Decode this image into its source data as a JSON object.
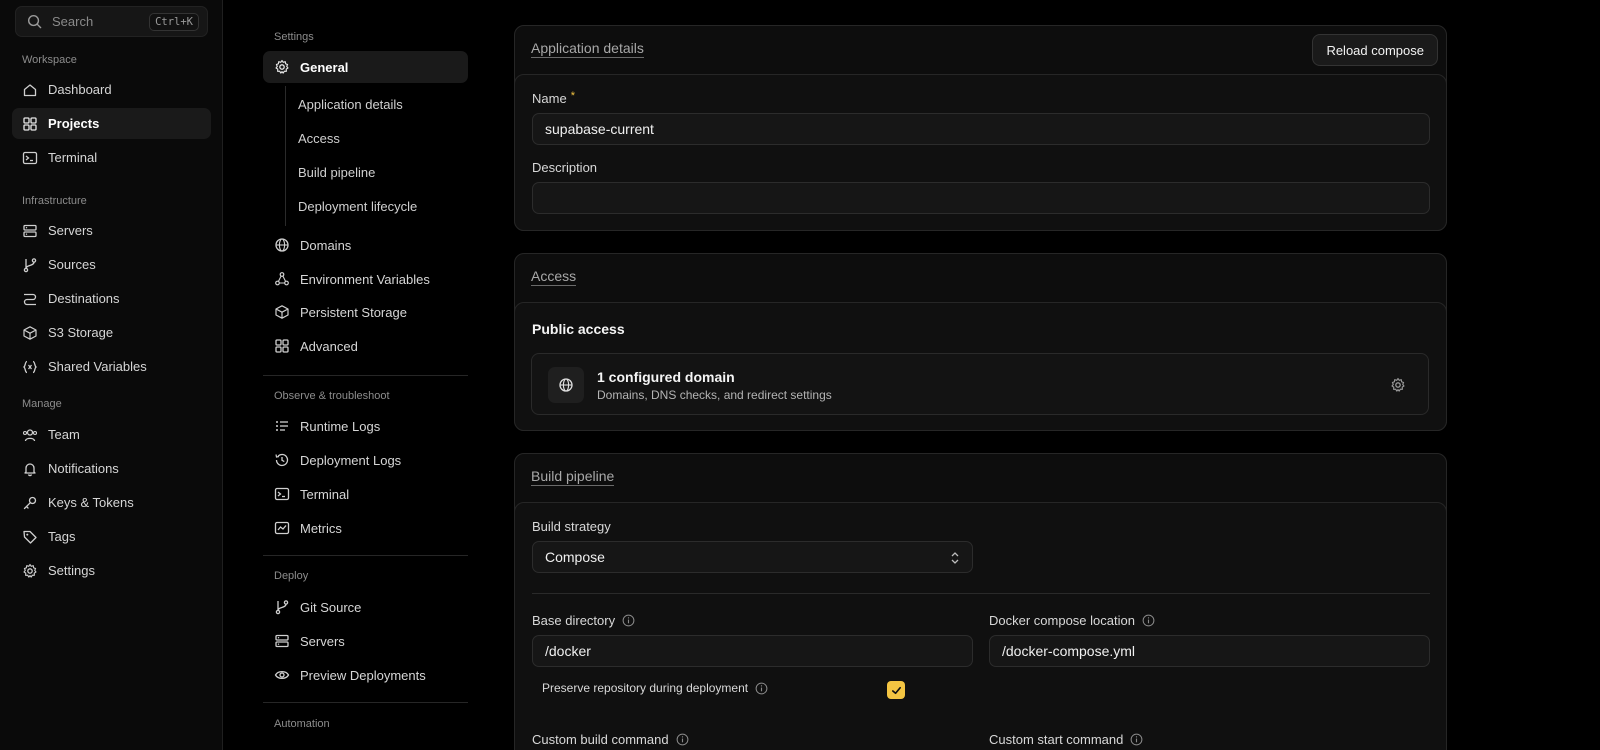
{
  "search": {
    "placeholder": "Search",
    "shortcut": "Ctrl+K"
  },
  "sidebar": {
    "groups": [
      {
        "label": "Workspace"
      },
      {
        "label": "Infrastructure"
      },
      {
        "label": "Manage"
      }
    ],
    "items": [
      {
        "label": "Dashboard",
        "icon": "home-icon"
      },
      {
        "label": "Projects",
        "icon": "grid-icon",
        "active": true
      },
      {
        "label": "Terminal",
        "icon": "terminal-icon"
      },
      {
        "label": "Servers",
        "icon": "server-icon"
      },
      {
        "label": "Sources",
        "icon": "git-branch-icon"
      },
      {
        "label": "Destinations",
        "icon": "route-icon"
      },
      {
        "label": "S3 Storage",
        "icon": "box-icon"
      },
      {
        "label": "Shared Variables",
        "icon": "variable-icon"
      },
      {
        "label": "Team",
        "icon": "users-icon"
      },
      {
        "label": "Notifications",
        "icon": "bell-icon"
      },
      {
        "label": "Keys & Tokens",
        "icon": "key-icon"
      },
      {
        "label": "Tags",
        "icon": "tag-icon"
      },
      {
        "label": "Settings",
        "icon": "gear-icon"
      }
    ]
  },
  "settings_nav": {
    "section_settings": "Settings",
    "general": "General",
    "sub_items": [
      "Application details",
      "Access",
      "Build pipeline",
      "Deployment lifecycle"
    ],
    "items": [
      "Domains",
      "Environment Variables",
      "Persistent Storage",
      "Advanced"
    ],
    "section_observe": "Observe & troubleshoot",
    "observe_items": [
      "Runtime Logs",
      "Deployment Logs",
      "Terminal",
      "Metrics"
    ],
    "section_deploy": "Deploy",
    "deploy_items": [
      "Git Source",
      "Servers",
      "Preview Deployments"
    ],
    "section_automation": "Automation"
  },
  "app_details": {
    "title": "Application details",
    "reload_button": "Reload compose",
    "name_label": "Name",
    "name_required": "*",
    "name_value": "supabase-current",
    "description_label": "Description",
    "description_value": ""
  },
  "access": {
    "title": "Access",
    "public_access": "Public access",
    "domain_title": "1 configured domain",
    "domain_sub": "Domains, DNS checks, and redirect settings"
  },
  "build": {
    "title": "Build pipeline",
    "strategy_label": "Build strategy",
    "strategy_value": "Compose",
    "base_dir_label": "Base directory",
    "base_dir_value": "/docker",
    "compose_loc_label": "Docker compose location",
    "compose_loc_value": "/docker-compose.yml",
    "preserve_label": "Preserve repository during deployment",
    "preserve_checked": true,
    "custom_build_label": "Custom build command",
    "custom_start_label": "Custom start command"
  },
  "colors": {
    "accent": "#f4c542",
    "background": "#000000",
    "card": "#0d0d0d"
  }
}
